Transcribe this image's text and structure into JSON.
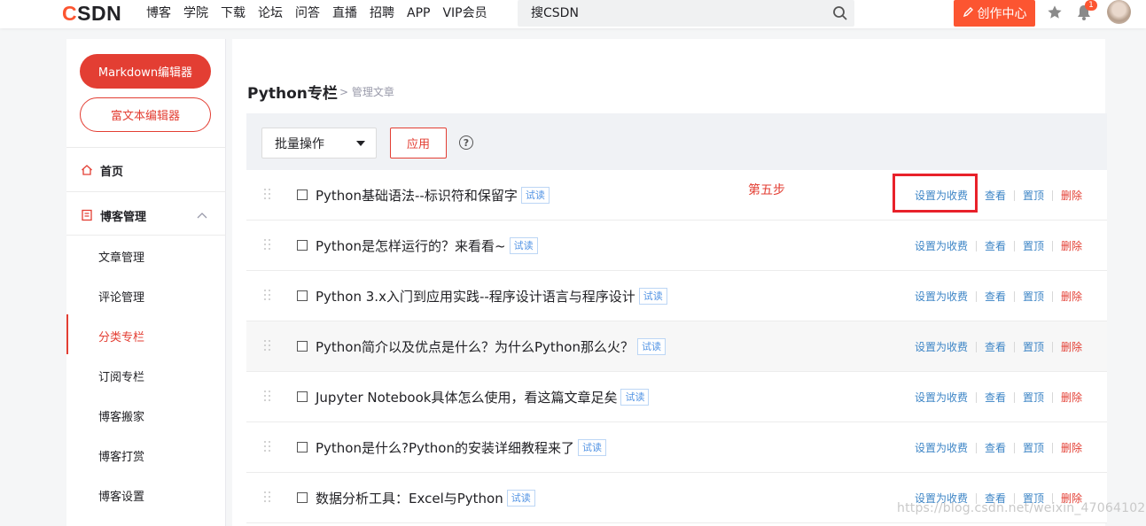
{
  "header": {
    "logo_first": "C",
    "logo_rest": "SDN",
    "nav": [
      "博客",
      "学院",
      "下载",
      "论坛",
      "问答",
      "直播",
      "招聘",
      "APP",
      "VIP会员"
    ],
    "search_text": "搜CSDN",
    "create_label": "创作中心",
    "notification_count": "1"
  },
  "sidebar": {
    "markdown_editor": "Markdown编辑器",
    "richtext_editor": "富文本编辑器",
    "home": "首页",
    "blog_manage": "博客管理",
    "items": [
      "文章管理",
      "评论管理",
      "分类专栏",
      "订阅专栏",
      "博客搬家",
      "博客打赏",
      "博客设置"
    ],
    "active_item": "分类专栏"
  },
  "main": {
    "title": "Python专栏",
    "breadcrumb": "> 管理文章",
    "bulk_label": "批量操作",
    "apply_label": "应用",
    "help": "?",
    "annotation": "第五步",
    "trial_label": "试读",
    "actions": {
      "set_paid": "设置为收费",
      "view": "查看",
      "pin": "置顶",
      "delete": "删除"
    },
    "articles": [
      {
        "title": "Python基础语法--标识符和保留字"
      },
      {
        "title": "Python是怎样运行的？来看看~"
      },
      {
        "title": "Python 3.x入门到应用实践--程序设计语言与程序设计"
      },
      {
        "title": "Python简介以及优点是什么？为什么Python那么火？"
      },
      {
        "title": "Jupyter Notebook具体怎么使用，看这篇文章足矣"
      },
      {
        "title": "Python是什么?Python的安装详细教程来了"
      },
      {
        "title": "数据分析工具：Excel与Python"
      }
    ]
  },
  "watermark": "https://blog.csdn.net/weixin_47064102",
  "colors": {
    "brand": "#fc5531",
    "accent_red": "#e33e33",
    "link_blue": "#3d85c6"
  }
}
